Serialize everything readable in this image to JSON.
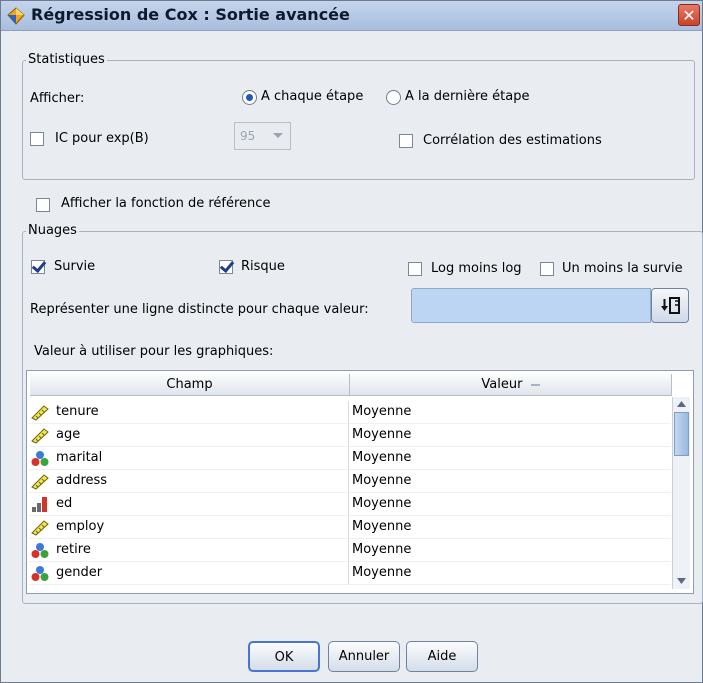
{
  "window": {
    "title": "Régression de Cox : Sortie avancée"
  },
  "statistiques": {
    "legend": "Statistiques",
    "afficher_label": "Afficher:",
    "radio_each": "A chaque étape",
    "radio_last": "A la dernière étape",
    "ic_label": "IC pour exp(B)",
    "ic_value": "95",
    "corr_label": "Corrélation des estimations"
  },
  "baseline_label": "Afficher la fonction de référence",
  "nuages": {
    "legend": "Nuages",
    "survie": "Survie",
    "risque": "Risque",
    "log_moins_log": "Log moins log",
    "un_moins_survie": "Un moins la survie",
    "separate_line_label": "Représenter une ligne distincte pour chaque valeur:",
    "plot_values_label": "Valeur à utiliser pour les graphiques:"
  },
  "table": {
    "columns": [
      "Champ",
      "Valeur"
    ],
    "rows": [
      {
        "field": "tenure",
        "value": "Moyenne",
        "icon": "ruler-icon"
      },
      {
        "field": "age",
        "value": "Moyenne",
        "icon": "ruler-icon"
      },
      {
        "field": "marital",
        "value": "Moyenne",
        "icon": "nominal-balls-icon"
      },
      {
        "field": "address",
        "value": "Moyenne",
        "icon": "ruler-icon"
      },
      {
        "field": "ed",
        "value": "Moyenne",
        "icon": "ordinal-bars-icon"
      },
      {
        "field": "employ",
        "value": "Moyenne",
        "icon": "ruler-icon"
      },
      {
        "field": "retire",
        "value": "Moyenne",
        "icon": "nominal-balls-icon"
      },
      {
        "field": "gender",
        "value": "Moyenne",
        "icon": "nominal-balls-icon"
      }
    ]
  },
  "buttons": {
    "ok": "OK",
    "annuler": "Annuler",
    "aide": "Aide"
  },
  "state": {
    "radio_each_selected": true,
    "survie_checked": true,
    "risque_checked": true,
    "ic_checked": false,
    "corr_checked": false,
    "baseline_checked": false,
    "log_checked": false,
    "un_moins_checked": false
  },
  "colors": {
    "accent": "#1f58c4",
    "field_highlight": "#bcd5f2"
  }
}
